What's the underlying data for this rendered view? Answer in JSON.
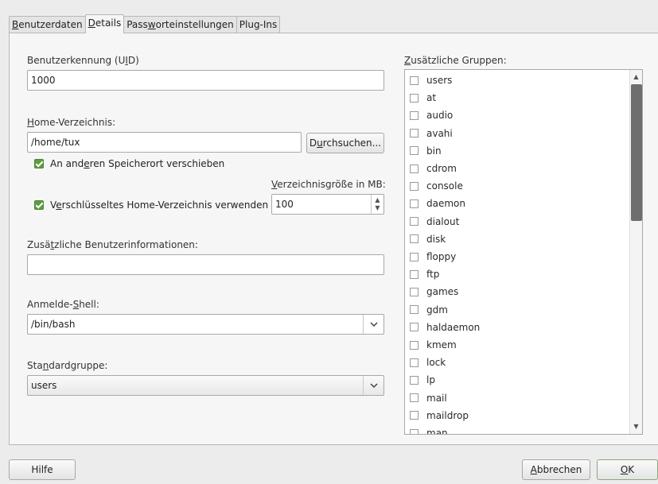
{
  "tabs": [
    {
      "pre": "",
      "key": "B",
      "post": "enutzerdaten"
    },
    {
      "pre": "",
      "key": "D",
      "post": "etails"
    },
    {
      "pre": "Pass",
      "key": "w",
      "post": "orteinstellungen"
    },
    {
      "pre": "Plug-Ins",
      "key": "",
      "post": ""
    }
  ],
  "uid": {
    "label_pre": "Benutzerkennung (U",
    "label_key": "I",
    "label_post": "D)",
    "value": "1000"
  },
  "home": {
    "label_pre": "",
    "label_key": "H",
    "label_post": "ome-Verzeichnis:",
    "value": "/home/tux",
    "browse_pre": "D",
    "browse_key": "u",
    "browse_post": "rchsuchen..."
  },
  "move_checkbox": {
    "pre": "An and",
    "key": "e",
    "post": "ren Speicherort verschieben"
  },
  "size": {
    "label_pre": "",
    "label_key": "V",
    "label_post": "erzeichnisgröße in MB:",
    "value": "100"
  },
  "encrypt_checkbox": {
    "pre": "V",
    "key": "e",
    "post": "rschlüsseltes Home-Verzeichnis verwenden"
  },
  "info": {
    "label_pre": "Zusä",
    "label_key": "t",
    "label_post": "zliche Benutzerinformationen:",
    "value": ""
  },
  "shell": {
    "label_pre": "Anmelde-",
    "label_key": "S",
    "label_post": "hell:",
    "value": "/bin/bash"
  },
  "group": {
    "label_pre": "Sta",
    "label_key": "n",
    "label_post": "dardgruppe:",
    "value": "users"
  },
  "additional_groups": {
    "label_pre": "",
    "label_key": "Z",
    "label_post": "usätzliche Gruppen:",
    "items": [
      "users",
      "at",
      "audio",
      "avahi",
      "bin",
      "cdrom",
      "console",
      "daemon",
      "dialout",
      "disk",
      "floppy",
      "ftp",
      "games",
      "gdm",
      "haldaemon",
      "kmem",
      "lock",
      "lp",
      "mail",
      "maildrop",
      "man"
    ]
  },
  "buttons": {
    "help": "Hilfe",
    "cancel_key": "A",
    "cancel_post": "bbrechen",
    "ok_key": "O",
    "ok_post": "K"
  },
  "icons": {
    "dropdown": "chevron-down-icon",
    "spin": "spin-arrows-icon",
    "scroll": "scroll-arrows-icon"
  }
}
